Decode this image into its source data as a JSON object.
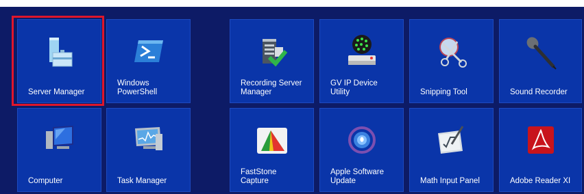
{
  "tiles": [
    {
      "label": "Server Manager",
      "icon": "server-manager-icon"
    },
    {
      "label": "Windows\nPowerShell",
      "icon": "powershell-icon"
    },
    {
      "label": "Recording Server\nManager",
      "icon": "recording-server-manager-icon"
    },
    {
      "label": "GV IP Device\nUtility",
      "icon": "gv-ip-device-utility-icon"
    },
    {
      "label": "Snipping Tool",
      "icon": "snipping-tool-icon"
    },
    {
      "label": "Sound Recorder",
      "icon": "sound-recorder-icon"
    },
    {
      "label": "Computer",
      "icon": "computer-icon"
    },
    {
      "label": "Task Manager",
      "icon": "task-manager-icon"
    },
    {
      "label": "FastStone\nCapture",
      "icon": "faststone-capture-icon"
    },
    {
      "label": "Apple Software\nUpdate",
      "icon": "apple-software-update-icon"
    },
    {
      "label": "Math Input Panel",
      "icon": "math-input-panel-icon"
    },
    {
      "label": "Adobe Reader XI",
      "icon": "adobe-reader-icon"
    }
  ],
  "colors": {
    "background": "#0d1b66",
    "tile": "#0a35a9",
    "highlight": "#e0162b"
  }
}
